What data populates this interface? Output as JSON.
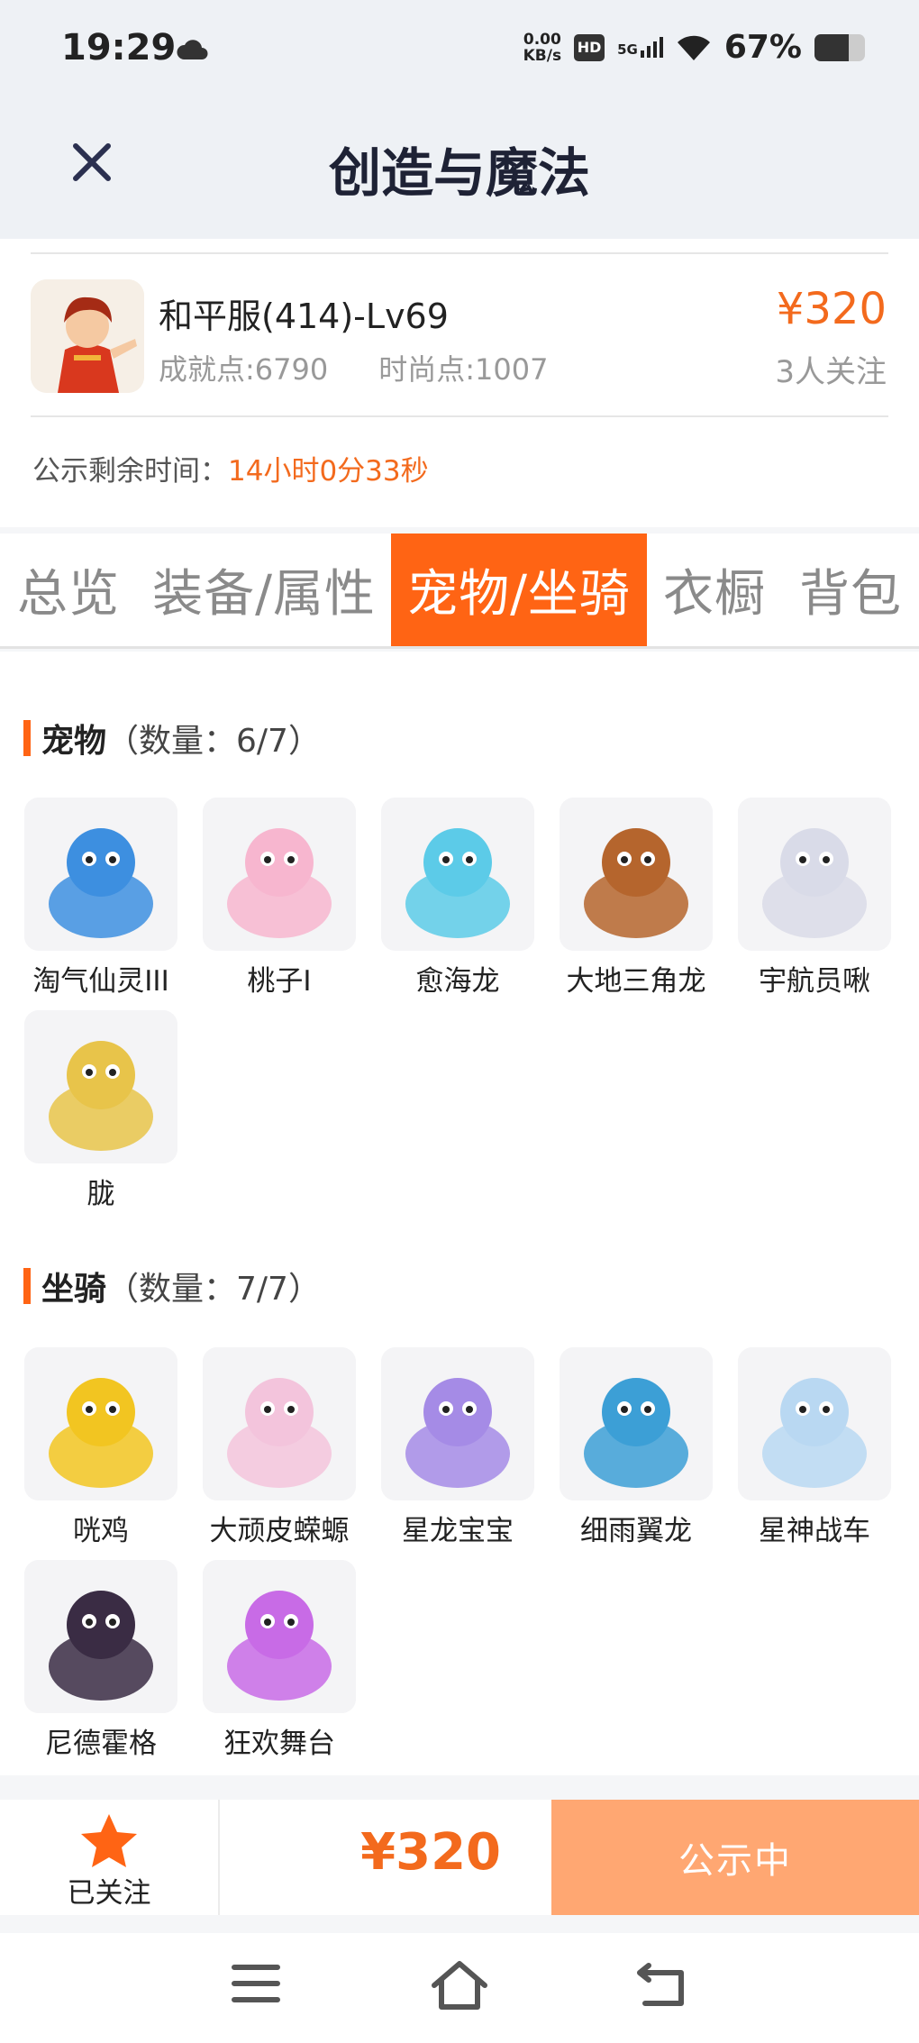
{
  "status_bar": {
    "time": "19:29",
    "net_speed_value": "0.00",
    "net_speed_unit": "KB/s",
    "hd": "HD",
    "signal": "5G",
    "battery": "67%",
    "battery_level": 0.67
  },
  "header": {
    "title": "创造与魔法"
  },
  "account": {
    "name": "和平服(414)-Lv69",
    "achievement": "成就点:6790",
    "fashion": "时尚点:1007",
    "price": "¥320",
    "followers": "3人关注",
    "notice_label": "公示剩余时间：",
    "notice_value": "14小时0分33秒"
  },
  "tabs": [
    {
      "label": "总览",
      "active": false
    },
    {
      "label": "装备/属性",
      "active": false
    },
    {
      "label": "宠物/坐骑",
      "active": true
    },
    {
      "label": "衣橱",
      "active": false
    },
    {
      "label": "背包",
      "active": false
    }
  ],
  "pets": {
    "title": "宠物",
    "count": "（数量：6/7）",
    "items": [
      {
        "name": "淘气仙灵III",
        "icon": "blue-dog-pet-icon",
        "color": "#3d8fe0"
      },
      {
        "name": "桃子I",
        "icon": "pink-cat-pet-icon",
        "color": "#f7b6cf"
      },
      {
        "name": "愈海龙",
        "icon": "sea-dragon-pet-icon",
        "color": "#5ccbe8"
      },
      {
        "name": "大地三角龙",
        "icon": "triceratops-pet-icon",
        "color": "#b5652d"
      },
      {
        "name": "宇航员啾",
        "icon": "astronaut-pet-icon",
        "color": "#d9dbe8"
      },
      {
        "name": "胧",
        "icon": "golden-spirit-pet-icon",
        "color": "#e8c44a"
      }
    ]
  },
  "mounts": {
    "title": "坐骑",
    "count": "（数量：7/7）",
    "items": [
      {
        "name": "咣鸡",
        "icon": "yellow-chicken-mount-icon",
        "color": "#f2c521"
      },
      {
        "name": "大顽皮蝾螈",
        "icon": "axolotl-mount-icon",
        "color": "#f3c4dc"
      },
      {
        "name": "星龙宝宝",
        "icon": "star-dragon-mount-icon",
        "color": "#a58be6"
      },
      {
        "name": "细雨翼龙",
        "icon": "pterosaur-mount-icon",
        "color": "#3c9fd6"
      },
      {
        "name": "星神战车",
        "icon": "celestial-horse-mount-icon",
        "color": "#b9d8f2"
      },
      {
        "name": "尼德霍格",
        "icon": "black-dragon-mount-icon",
        "color": "#3a2c44"
      },
      {
        "name": "狂欢舞台",
        "icon": "carnival-stage-mount-icon",
        "color": "#c86be6"
      }
    ]
  },
  "bottom_bar": {
    "follow_label": "已关注",
    "price": "¥320",
    "status_label": "公示中"
  }
}
